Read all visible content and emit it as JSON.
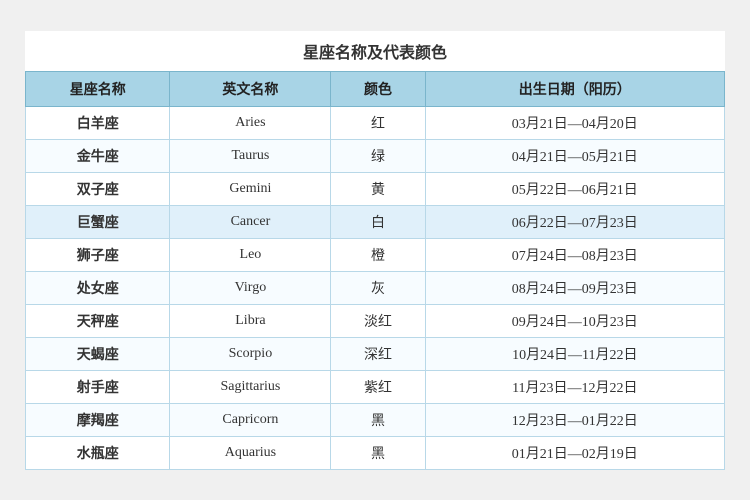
{
  "title": "星座名称及代表颜色",
  "headers": [
    "星座名称",
    "英文名称",
    "颜色",
    "出生日期（阳历）"
  ],
  "rows": [
    {
      "name": "白羊座",
      "english": "Aries",
      "color": "红",
      "dates": "03月21日—04月20日"
    },
    {
      "name": "金牛座",
      "english": "Taurus",
      "color": "绿",
      "dates": "04月21日—05月21日"
    },
    {
      "name": "双子座",
      "english": "Gemini",
      "color": "黄",
      "dates": "05月22日—06月21日"
    },
    {
      "name": "巨蟹座",
      "english": "Cancer",
      "color": "白",
      "dates": "06月22日—07月23日"
    },
    {
      "name": "狮子座",
      "english": "Leo",
      "color": "橙",
      "dates": "07月24日—08月23日"
    },
    {
      "name": "处女座",
      "english": "Virgo",
      "color": "灰",
      "dates": "08月24日—09月23日"
    },
    {
      "name": "天秤座",
      "english": "Libra",
      "color": "淡红",
      "dates": "09月24日—10月23日"
    },
    {
      "name": "天蝎座",
      "english": "Scorpio",
      "color": "深红",
      "dates": "10月24日—11月22日"
    },
    {
      "name": "射手座",
      "english": "Sagittarius",
      "color": "紫红",
      "dates": "11月23日—12月22日"
    },
    {
      "name": "摩羯座",
      "english": "Capricorn",
      "color": "黑",
      "dates": "12月23日—01月22日"
    },
    {
      "name": "水瓶座",
      "english": "Aquarius",
      "color": "黑",
      "dates": "01月21日—02月19日"
    }
  ]
}
